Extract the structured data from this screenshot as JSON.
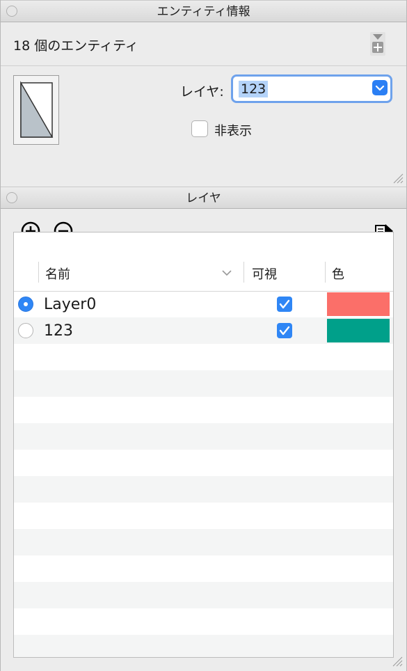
{
  "entity_panel": {
    "title": "エンティティ情報",
    "count_text": "18 個のエンティティ",
    "layer_label": "レイヤ:",
    "layer_value": "123",
    "hidden_label": "非表示",
    "hidden_checked": false
  },
  "layers_panel": {
    "title": "レイヤ",
    "columns": {
      "name": "名前",
      "visible": "可視",
      "color": "色"
    },
    "rows": [
      {
        "name": "Layer0",
        "active": true,
        "visible": true,
        "color": "#fb6f69"
      },
      {
        "name": "123",
        "active": false,
        "visible": true,
        "color": "#00a08a"
      }
    ]
  },
  "icons": [
    "close-dot-icon",
    "add-to-layer-icon",
    "entity-thumbnail-icon",
    "chevron-down-icon",
    "add-layer-icon",
    "remove-layer-icon",
    "details-arrow-icon",
    "sort-chevron-icon",
    "checkbox-check-icon",
    "resize-grip-icon"
  ],
  "colors": {
    "accent": "#2f86f5",
    "focus_ring": "#6ea2ec",
    "selection": "#b4d3f9"
  }
}
